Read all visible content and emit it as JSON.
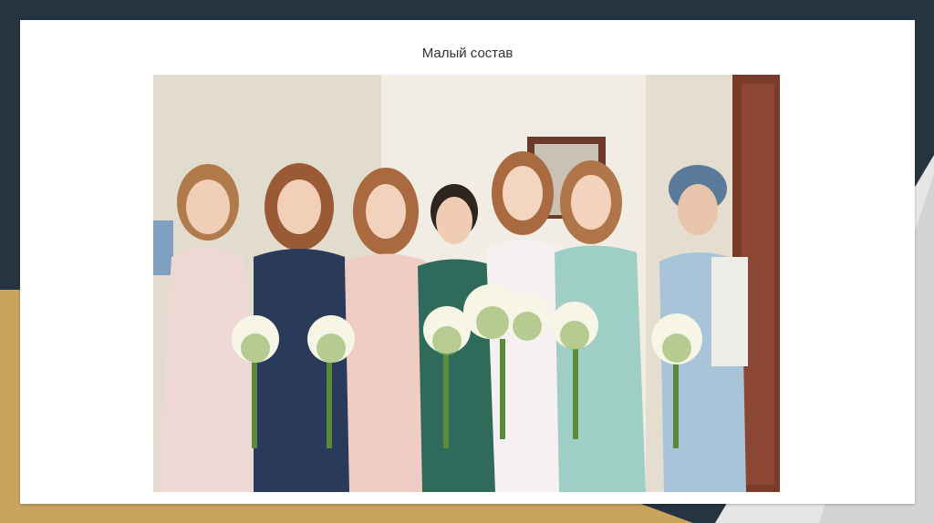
{
  "slide": {
    "title": "Малый состав"
  },
  "photo": {
    "icon": "group-photo-icon"
  },
  "colors": {
    "background_dark": "#243440",
    "accent_gold": "#c9a45c",
    "slide_white": "#ffffff",
    "title_text": "#333333"
  }
}
